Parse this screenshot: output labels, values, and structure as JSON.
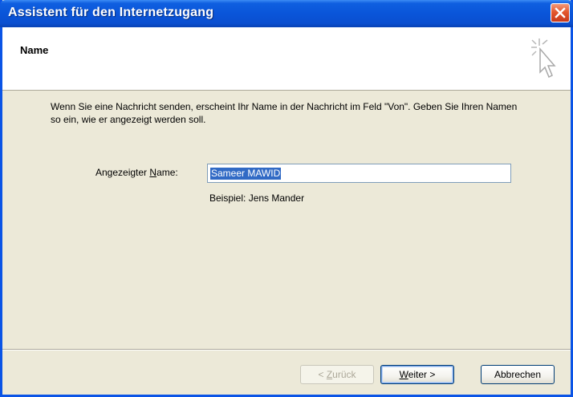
{
  "window": {
    "title": "Assistent für den Internetzugang",
    "close_icon": "close-icon"
  },
  "header": {
    "title": "Name",
    "icon": "wizard-cursor-icon"
  },
  "body": {
    "description": "Wenn Sie eine Nachricht senden, erscheint Ihr Name in der Nachricht im Feld \"Von\". Geben Sie Ihren Namen so ein, wie er angezeigt werden soll.",
    "name_label_prefix": "Angezeigter ",
    "name_label_accel": "N",
    "name_label_suffix": "ame:",
    "name_value": "Sameer MAWID",
    "example": "Beispiel: Jens Mander"
  },
  "buttons": {
    "back_prefix": "< ",
    "back_accel": "Z",
    "back_suffix": "urück",
    "next_accel": "W",
    "next_suffix": "eiter >",
    "cancel": "Abbrechen"
  },
  "colors": {
    "titlebar": "#0a55d9",
    "selection": "#316ac5",
    "face": "#ece9d8"
  }
}
